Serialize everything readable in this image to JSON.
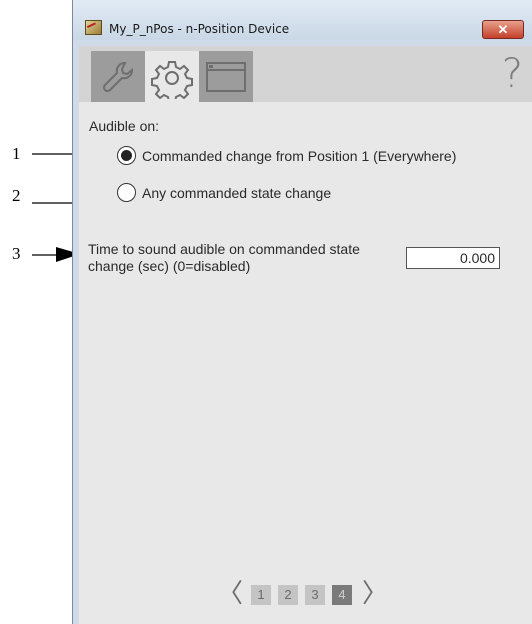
{
  "callouts": [
    "1",
    "2",
    "3"
  ],
  "window": {
    "title": "My_P_nPos - n-Position Device",
    "close_label": "✕"
  },
  "tabs": [
    {
      "name": "wrench-icon",
      "active": false
    },
    {
      "name": "gear-icon",
      "active": true
    },
    {
      "name": "window-icon",
      "active": false
    }
  ],
  "help_label": "?",
  "panel": {
    "audible_label": "Audible on:",
    "radio_options": [
      {
        "label": "Commanded change from Position 1 (Everywhere)",
        "checked": true
      },
      {
        "label": "Any commanded state change",
        "checked": false
      }
    ],
    "time_label": "Time to sound audible on commanded state change (sec) (0=disabled)",
    "time_value": "0.000"
  },
  "pager": {
    "prev": "〈",
    "next": "〉",
    "pages": [
      "1",
      "2",
      "3",
      "4"
    ],
    "current_page": "4"
  }
}
